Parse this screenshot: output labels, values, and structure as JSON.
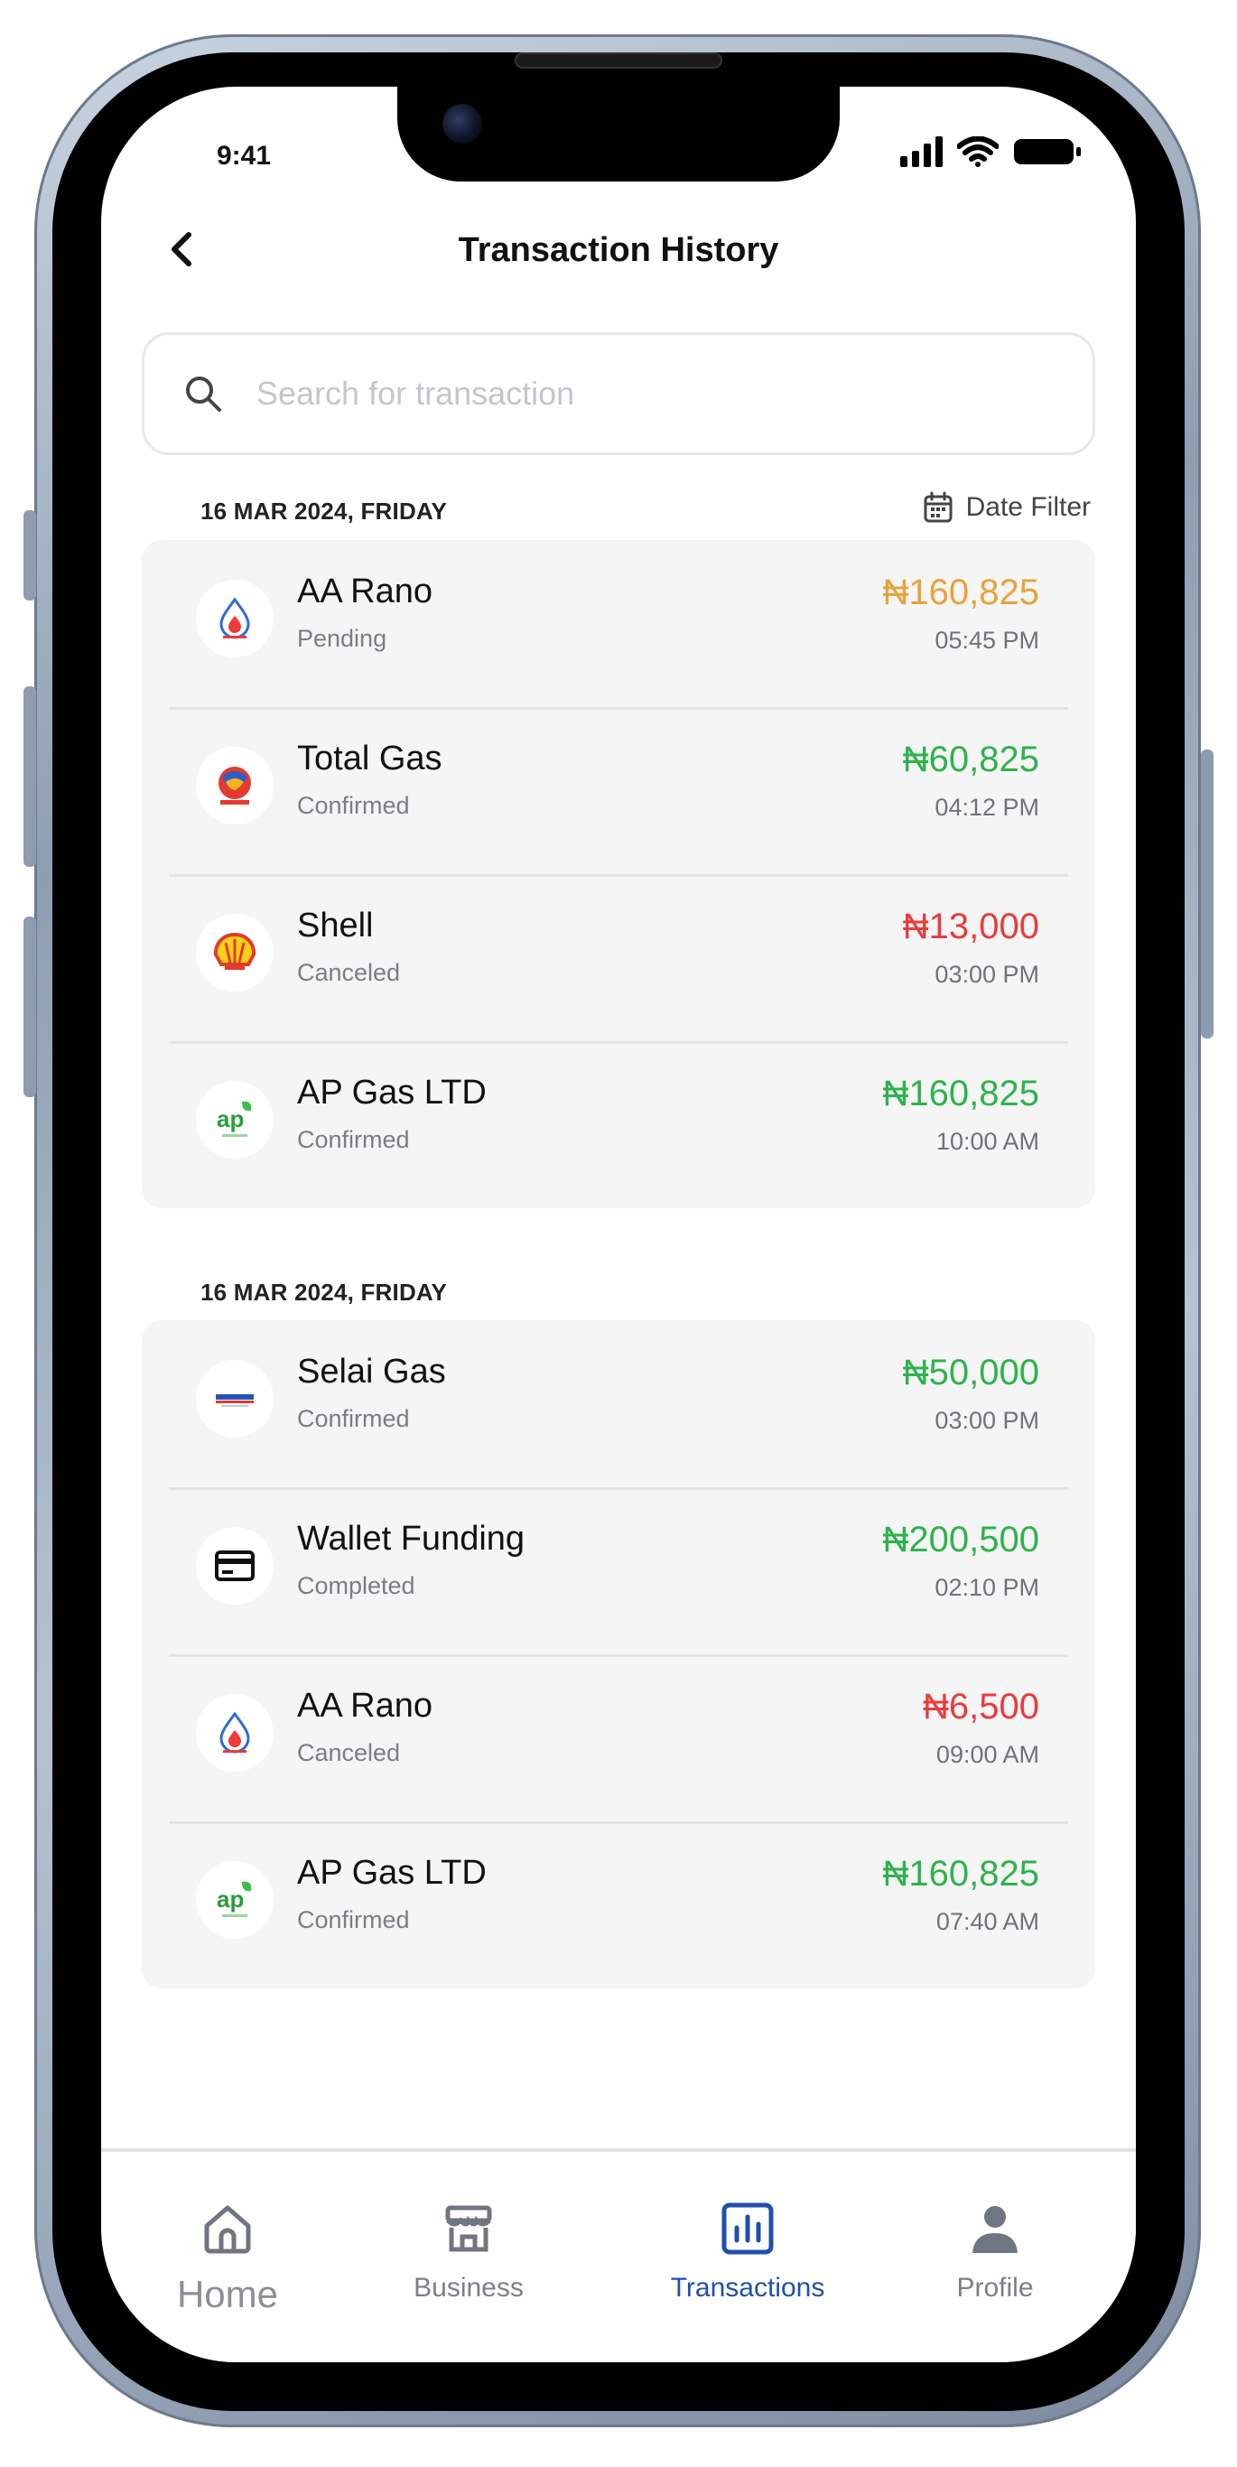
{
  "status_bar": {
    "time": "9:41"
  },
  "header": {
    "title": "Transaction History"
  },
  "search": {
    "placeholder": "Search for transaction",
    "value": ""
  },
  "filter": {
    "label": "Date Filter"
  },
  "groups": [
    {
      "date": "16 MAR 2024, FRIDAY",
      "transactions": [
        {
          "name": "AA Rano",
          "status": "Pending",
          "amount": "₦160,825",
          "time": "05:45 PM",
          "amount_color": "#e8a23a",
          "icon": "aa-rano-logo"
        },
        {
          "name": "Total Gas",
          "status": "Confirmed",
          "amount": "₦60,825",
          "time": "04:12 PM",
          "amount_color": "#2db34a",
          "icon": "total-logo"
        },
        {
          "name": "Shell",
          "status": "Canceled",
          "amount": "₦13,000",
          "time": "03:00 PM",
          "amount_color": "#ea3b3b",
          "icon": "shell-logo"
        },
        {
          "name": "AP Gas LTD",
          "status": "Confirmed",
          "amount": "₦160,825",
          "time": "10:00 AM",
          "amount_color": "#2db34a",
          "icon": "ap-logo"
        }
      ]
    },
    {
      "date": "16 MAR 2024, FRIDAY",
      "transactions": [
        {
          "name": "Selai Gas",
          "status": "Confirmed",
          "amount": "₦50,000",
          "time": "03:00 PM",
          "amount_color": "#2db34a",
          "icon": "selai-logo"
        },
        {
          "name": "Wallet Funding",
          "status": "Completed",
          "amount": "₦200,500",
          "time": "02:10 PM",
          "amount_color": "#2db34a",
          "icon": "card-icon"
        },
        {
          "name": "AA Rano",
          "status": "Canceled",
          "amount": "₦6,500",
          "time": "09:00 AM",
          "amount_color": "#ea3b3b",
          "icon": "aa-rano-logo"
        },
        {
          "name": "AP Gas LTD",
          "status": "Confirmed",
          "amount": "₦160,825",
          "time": "07:40 AM",
          "amount_color": "#2db34a",
          "icon": "ap-logo"
        }
      ]
    }
  ],
  "tabbar": {
    "items": [
      {
        "label": "Home",
        "icon": "home-icon",
        "active": false
      },
      {
        "label": "Business",
        "icon": "store-icon",
        "active": false
      },
      {
        "label": "Transactions",
        "icon": "bar-chart-icon",
        "active": true
      },
      {
        "label": "Profile",
        "icon": "user-icon",
        "active": false
      }
    ]
  },
  "colors": {
    "accent": "#1f4fae",
    "pending": "#e8a23a",
    "success": "#2db34a",
    "danger": "#ea3b3b"
  }
}
